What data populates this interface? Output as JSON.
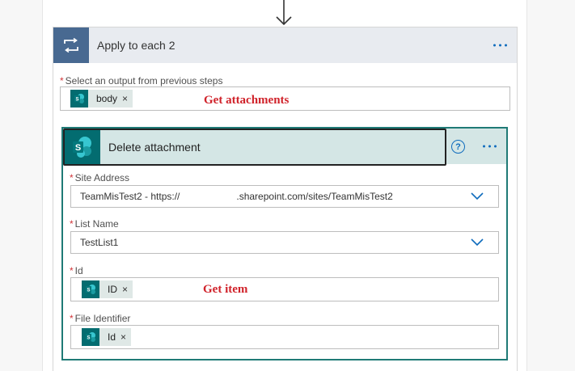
{
  "apply_each": {
    "title": "Apply to each 2",
    "select_label": "Select an output from previous steps",
    "token": {
      "text": "body",
      "remove": "×"
    },
    "annotation": "Get attachments"
  },
  "delete_action": {
    "title": "Delete attachment",
    "help": "?",
    "site_address": {
      "label": "Site Address",
      "value_prefix": "TeamMisTest2 - https://",
      "value_suffix": ".sharepoint.com/sites/TeamMisTest2"
    },
    "list_name": {
      "label": "List Name",
      "value": "TestList1"
    },
    "id_field": {
      "label": "Id",
      "token": "ID",
      "remove": "×",
      "annotation": "Get item"
    },
    "file_identifier": {
      "label": "File Identifier",
      "token": "Id",
      "remove": "×"
    }
  },
  "required_mark": "*",
  "colors": {
    "loop_header": "#486991",
    "sharepoint": "#036c70",
    "accent": "#0f6cbd",
    "annotation": "#d0222a"
  }
}
